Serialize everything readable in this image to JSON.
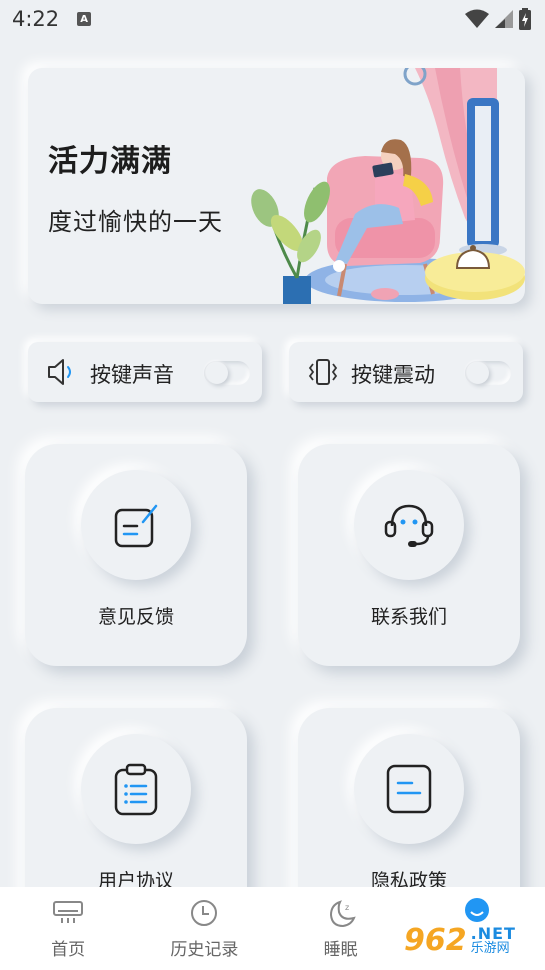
{
  "status_bar": {
    "time": "4:22",
    "notif_letter": "A"
  },
  "banner": {
    "title": "活力满满",
    "subtitle": "度过愉快的一天"
  },
  "toggles": [
    {
      "label": "按键声音",
      "icon": "speaker-icon",
      "on": false
    },
    {
      "label": "按键震动",
      "icon": "vibrate-icon",
      "on": false
    }
  ],
  "features": [
    {
      "label": "意见反馈",
      "icon": "feedback-edit-icon"
    },
    {
      "label": "联系我们",
      "icon": "headset-icon"
    },
    {
      "label": "用户协议",
      "icon": "clipboard-list-icon"
    },
    {
      "label": "隐私政策",
      "icon": "document-lines-icon"
    }
  ],
  "bottom_nav": [
    {
      "label": "首页",
      "icon": "air-conditioner-icon"
    },
    {
      "label": "历史记录",
      "icon": "clock-icon"
    },
    {
      "label": "睡眠",
      "icon": "moon-sleep-icon"
    },
    {
      "label": "",
      "icon": "profile-icon"
    }
  ],
  "watermark": {
    "number": "962",
    "suffix": ".NET",
    "site": "乐游网"
  },
  "colors": {
    "background": "#edf0f3",
    "accent": "#2196f3",
    "nav_active": "#2196f3"
  }
}
